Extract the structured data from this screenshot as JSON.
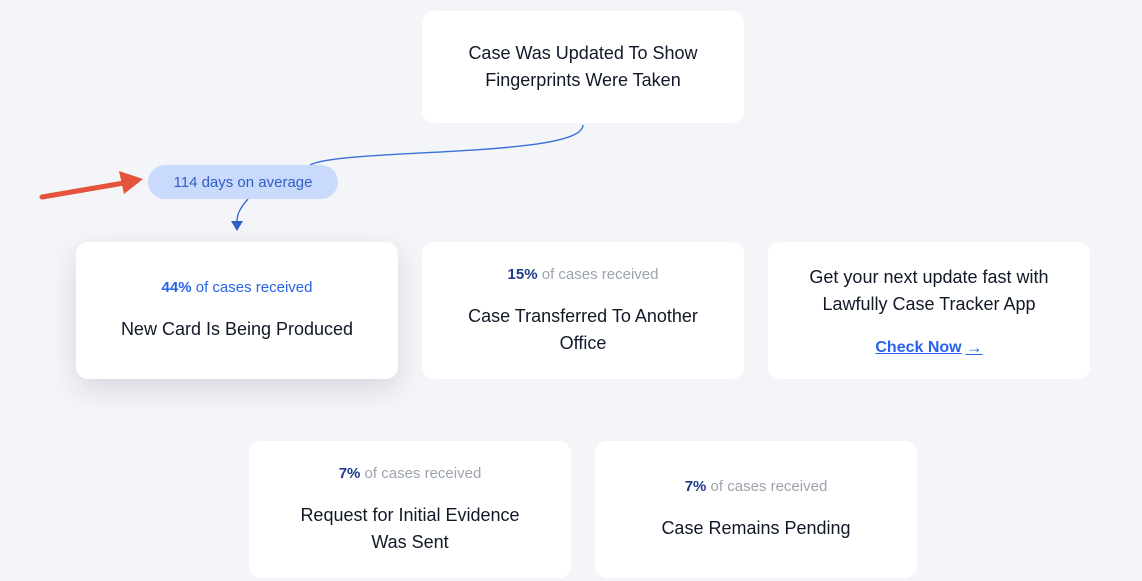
{
  "top_card": {
    "title_line1": "Case Was Updated To Show",
    "title_line2": "Fingerprints Were Taken"
  },
  "average_badge": {
    "label": "114 days on average"
  },
  "cards": [
    {
      "percent": "44%",
      "stat_suffix": " of cases received",
      "title_line1": "New Card Is Being Produced",
      "title_line2": ""
    },
    {
      "percent": "15%",
      "stat_suffix": " of cases received",
      "title_line1": "Case Transferred To Another",
      "title_line2": "Office"
    },
    {
      "percent": "7%",
      "stat_suffix": " of cases received",
      "title_line1": "Request for Initial Evidence",
      "title_line2": "Was Sent"
    },
    {
      "percent": "7%",
      "stat_suffix": " of cases received",
      "title_line1": "Case Remains Pending",
      "title_line2": ""
    }
  ],
  "promo": {
    "line1": "Get your next update fast with",
    "line2": "Lawfully Case Tracker App",
    "cta_label": "Check Now",
    "cta_arrow": "→"
  },
  "colors": {
    "accent": "#2563eb",
    "badge_bg": "#c9dafc",
    "annotation_arrow": "#e5533d"
  }
}
